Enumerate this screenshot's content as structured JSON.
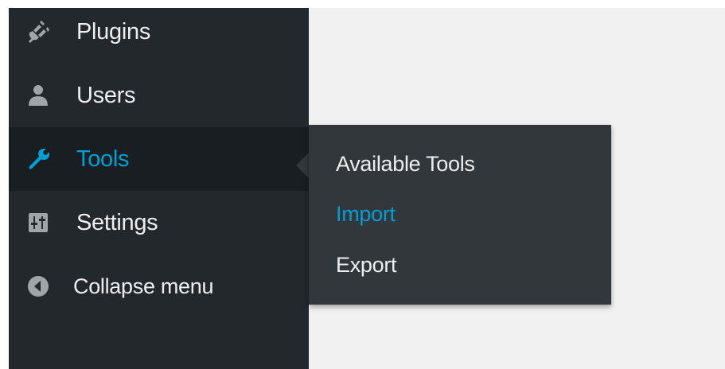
{
  "menu": {
    "items": [
      {
        "label": "Plugins",
        "icon": "plugin-icon"
      },
      {
        "label": "Users",
        "icon": "user-icon"
      },
      {
        "label": "Tools",
        "icon": "wrench-icon",
        "current": true
      },
      {
        "label": "Settings",
        "icon": "settings-icon"
      }
    ],
    "collapse_label": "Collapse menu"
  },
  "submenu": {
    "items": [
      {
        "label": "Available Tools"
      },
      {
        "label": "Import",
        "current": true
      },
      {
        "label": "Export"
      }
    ]
  },
  "colors": {
    "sidebar_bg": "#23282d",
    "current_item_bg": "#191e23",
    "flyout_bg": "#32373c",
    "accent": "#00a0d2",
    "text": "#eeeeee",
    "content_bg": "#f1f1f1"
  }
}
